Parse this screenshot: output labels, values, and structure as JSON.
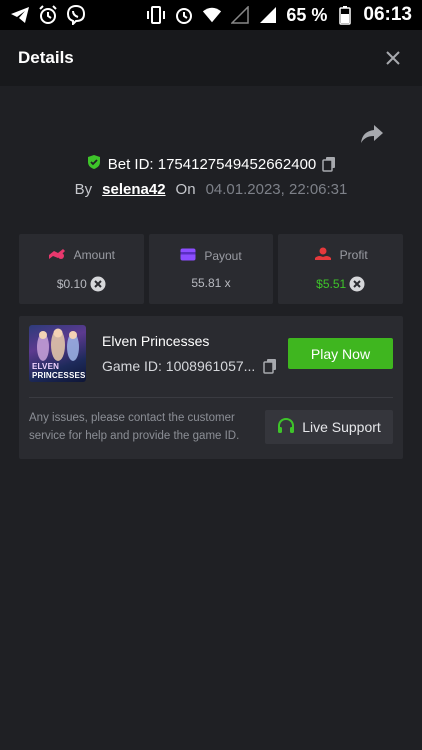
{
  "status_bar": {
    "battery": "65 %",
    "time": "06:13"
  },
  "header": {
    "title": "Details"
  },
  "bet": {
    "id_text": "Bet ID: 1754127549452662400",
    "by_label": "By",
    "username": "selena42",
    "on_label": "On",
    "date": "04.01.2023, 22:06:31"
  },
  "stats": [
    {
      "label": "Amount",
      "value": "$0.10",
      "icon": "coins-icon",
      "show_currency": true
    },
    {
      "label": "Payout",
      "value": "55.81 x",
      "icon": "card-icon",
      "show_currency": false
    },
    {
      "label": "Profit",
      "value": "$5.51",
      "icon": "profit-icon",
      "show_currency": true
    }
  ],
  "game": {
    "name": "Elven Princesses",
    "game_id": "Game ID: 1008961057...",
    "thumb_line1": "ELVEN",
    "thumb_line2": "PRINCESSES",
    "play_label": "Play Now"
  },
  "support": {
    "message": "Any issues, please contact the customer service for help and provide the game ID.",
    "button_label": "Live Support"
  },
  "colors": {
    "accent_green": "#3fb61f",
    "profit_green": "#3ec42a",
    "amount_icon": "#e8386d",
    "payout_icon": "#8c4dff",
    "profit_icon": "#e5393c"
  }
}
